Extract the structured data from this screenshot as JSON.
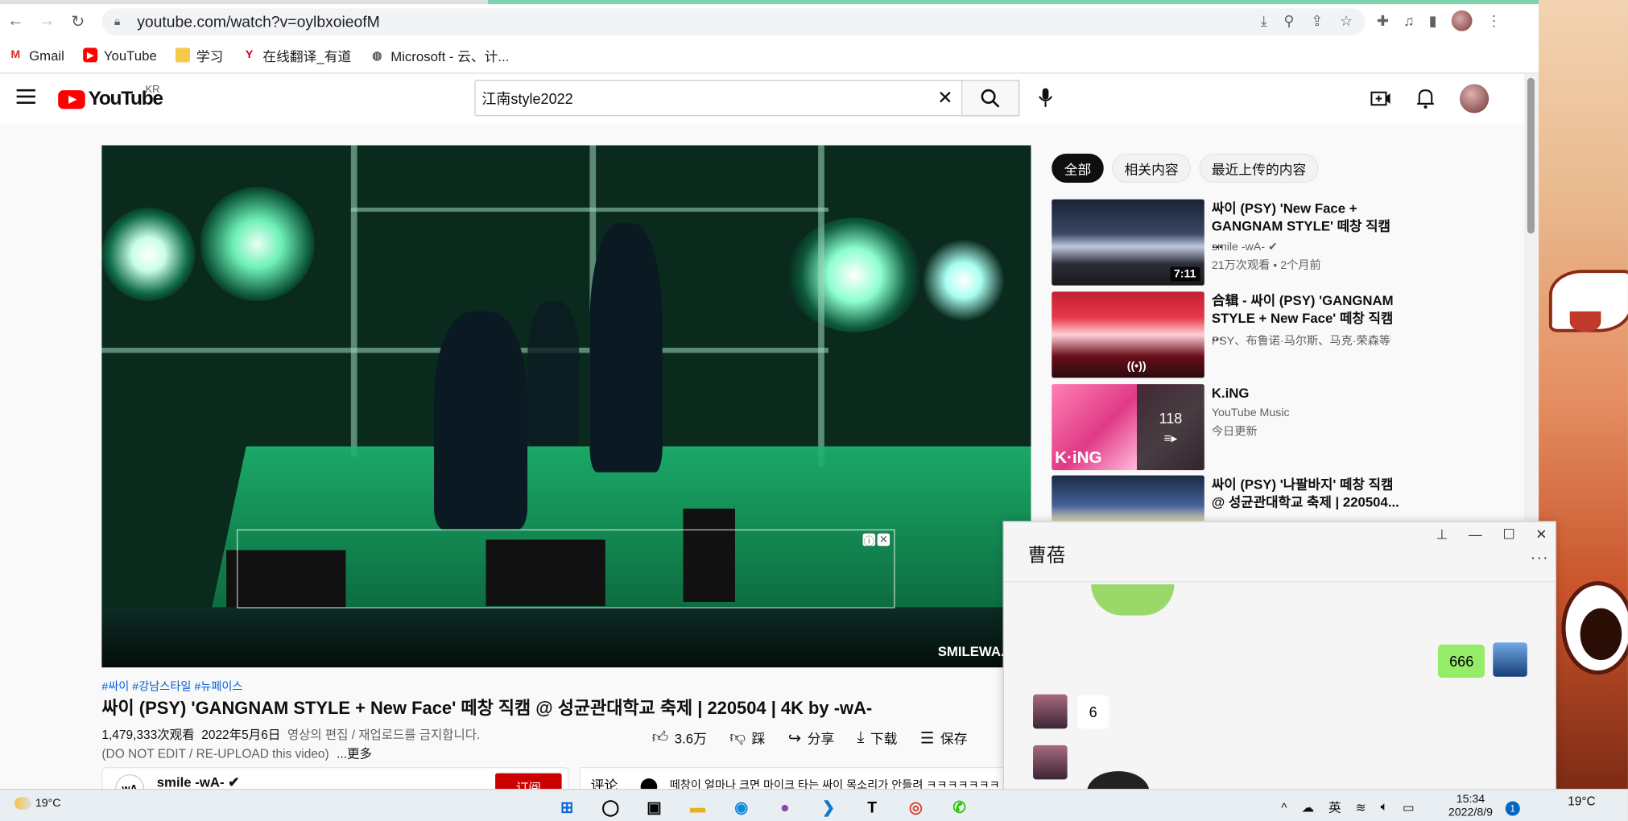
{
  "browser": {
    "url": "youtube.com/watch?v=oylbxoieofM",
    "bookmarks": [
      "Gmail",
      "YouTube",
      "学习",
      "在线翻译_有道",
      "Microsoft - 云、计..."
    ]
  },
  "youtube": {
    "country": "KR",
    "logo_text": "YouTube",
    "search_value": "江南style2022",
    "video": {
      "watermark": "SMILEWA.CO",
      "hashtags": "#싸이 #강남스타일 #뉴페이스",
      "title": "싸이 (PSY) 'GANGNAM STYLE + New Face' 떼창 직캠 @ 성균관대학교 축제 | 220504 | 4K by -wA-",
      "views": "1,479,333次观看",
      "date": "2022年5月6日",
      "desc_line1": "영상의 편집 / 재업로드를 금지합니다.",
      "desc_line2": "(DO NOT EDIT / RE-UPLOAD this video)",
      "more": "...更多",
      "likes": "3.6万",
      "dislike": "踩",
      "share": "分享",
      "download": "下载",
      "save": "保存",
      "channel": "smile -wA-",
      "subscribe": "订阅",
      "comments_label": "评论",
      "comment_preview": "떼창이 얼마나 크면 마이크 타는 싸이 목소리가 안들려 ㅋㅋㅋㅋㅋㅋㅋ"
    },
    "chips": [
      "全部",
      "相关内容",
      "最近上传的内容"
    ],
    "recs": [
      {
        "title": "싸이 (PSY) 'New Face + GANGNAM STYLE' 떼창 직캠 ...",
        "channel": "smile -wA-",
        "views": "21万次观看 • 2个月前",
        "duration": "7:11"
      },
      {
        "title": "合辑 - 싸이 (PSY) 'GANGNAM STYLE + New Face' 떼창 직캠 ...",
        "channel": "PSY、布鲁诺·马尔斯、马克·荣森等",
        "views": "",
        "duration": ""
      },
      {
        "title": "K.iNG",
        "channel": "YouTube Music",
        "views": "今日更新",
        "count": "118",
        "thumb_text": "K·iNG"
      },
      {
        "title": "싸이 (PSY) '나팔바지' 떼창 직캠 @ 성균관대학교 축제 | 220504...",
        "channel": "",
        "views": ""
      }
    ]
  },
  "chat": {
    "name": "曹蓓",
    "me_msg": "666",
    "other_msg": "6"
  },
  "taskbar": {
    "temp": "19°C",
    "time": "15:34",
    "date": "2022/8/9",
    "lang": "英",
    "notif": "1",
    "temp2": "19°C"
  },
  "colors": {
    "yt_red": "#ff0000",
    "link_blue": "#065fd4",
    "wechat_green": "#95ec69"
  }
}
